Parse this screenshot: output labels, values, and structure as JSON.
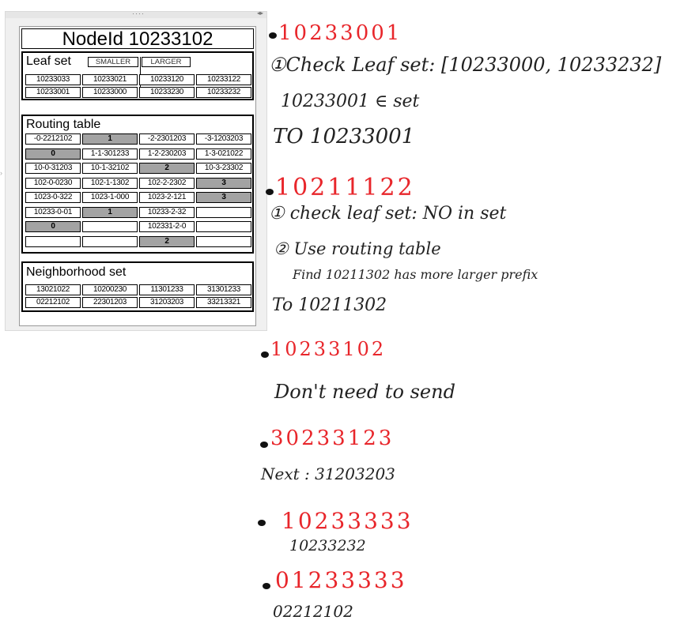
{
  "image": {
    "title": "NodeId 10233102",
    "leaf_set": {
      "label": "Leaf set",
      "headers": [
        "SMALLER",
        "LARGER"
      ],
      "rows": [
        [
          "10233033",
          "10233021",
          "10233120",
          "10233122"
        ],
        [
          "10233001",
          "10233000",
          "10233230",
          "10233232"
        ]
      ]
    },
    "routing_table": {
      "label": "Routing table",
      "rows": [
        [
          {
            "t": "-0-2212102",
            "d": false
          },
          {
            "t": "1",
            "d": true
          },
          {
            "t": "-2-2301203",
            "d": false
          },
          {
            "t": "-3-1203203",
            "d": false
          }
        ],
        [
          {
            "t": "0",
            "d": true
          },
          {
            "t": "1-1-301233",
            "d": false
          },
          {
            "t": "1-2-230203",
            "d": false
          },
          {
            "t": "1-3-021022",
            "d": false
          }
        ],
        [
          {
            "t": "10-0-31203",
            "d": false
          },
          {
            "t": "10-1-32102",
            "d": false
          },
          {
            "t": "2",
            "d": true
          },
          {
            "t": "10-3-23302",
            "d": false
          }
        ],
        [
          {
            "t": "102-0-0230",
            "d": false
          },
          {
            "t": "102-1-1302",
            "d": false
          },
          {
            "t": "102-2-2302",
            "d": false
          },
          {
            "t": "3",
            "d": true
          }
        ],
        [
          {
            "t": "1023-0-322",
            "d": false
          },
          {
            "t": "1023-1-000",
            "d": false
          },
          {
            "t": "1023-2-121",
            "d": false
          },
          {
            "t": "3",
            "d": true
          }
        ],
        [
          {
            "t": "10233-0-01",
            "d": false
          },
          {
            "t": "1",
            "d": true
          },
          {
            "t": "10233-2-32",
            "d": false
          },
          {
            "t": "",
            "d": false
          }
        ],
        [
          {
            "t": "0",
            "d": true
          },
          {
            "t": "",
            "d": false
          },
          {
            "t": "102331-2-0",
            "d": false
          },
          {
            "t": "",
            "d": false
          }
        ],
        [
          {
            "t": "",
            "d": false
          },
          {
            "t": "",
            "d": false
          },
          {
            "t": "2",
            "d": true
          },
          {
            "t": "",
            "d": false
          }
        ]
      ]
    },
    "neighborhood_set": {
      "label": "Neighborhood set",
      "rows": [
        [
          "13021022",
          "10200230",
          "11301233",
          "31301233"
        ],
        [
          "02212102",
          "22301203",
          "31203203",
          "33213321"
        ]
      ]
    }
  },
  "notes": {
    "n1_key": "10233001",
    "n1_step1": "①Check Leaf set: [10233000, 10233232]",
    "n1_member": "10233001 ∈ set",
    "n1_result": "TO 10233001",
    "n2_key": "10211122",
    "n2_step1": "① check leaf set: NO in set",
    "n2_step2": "② Use routing table",
    "n2_find": "Find 10211302 has more larger prefix",
    "n2_result": "To 10211302",
    "n3_key": "10233102",
    "n3_result": "Don't need to send",
    "n4_key": "30233123",
    "n4_result": "Next : 31203203",
    "n5_key": "10233333",
    "n5_result": "10233232",
    "n6_key": "01233333",
    "n6_result": "02212102"
  },
  "colors": {
    "ink": "#222222",
    "red_ink": "#e8262b",
    "shaded_cell": "#a3a3a3"
  }
}
